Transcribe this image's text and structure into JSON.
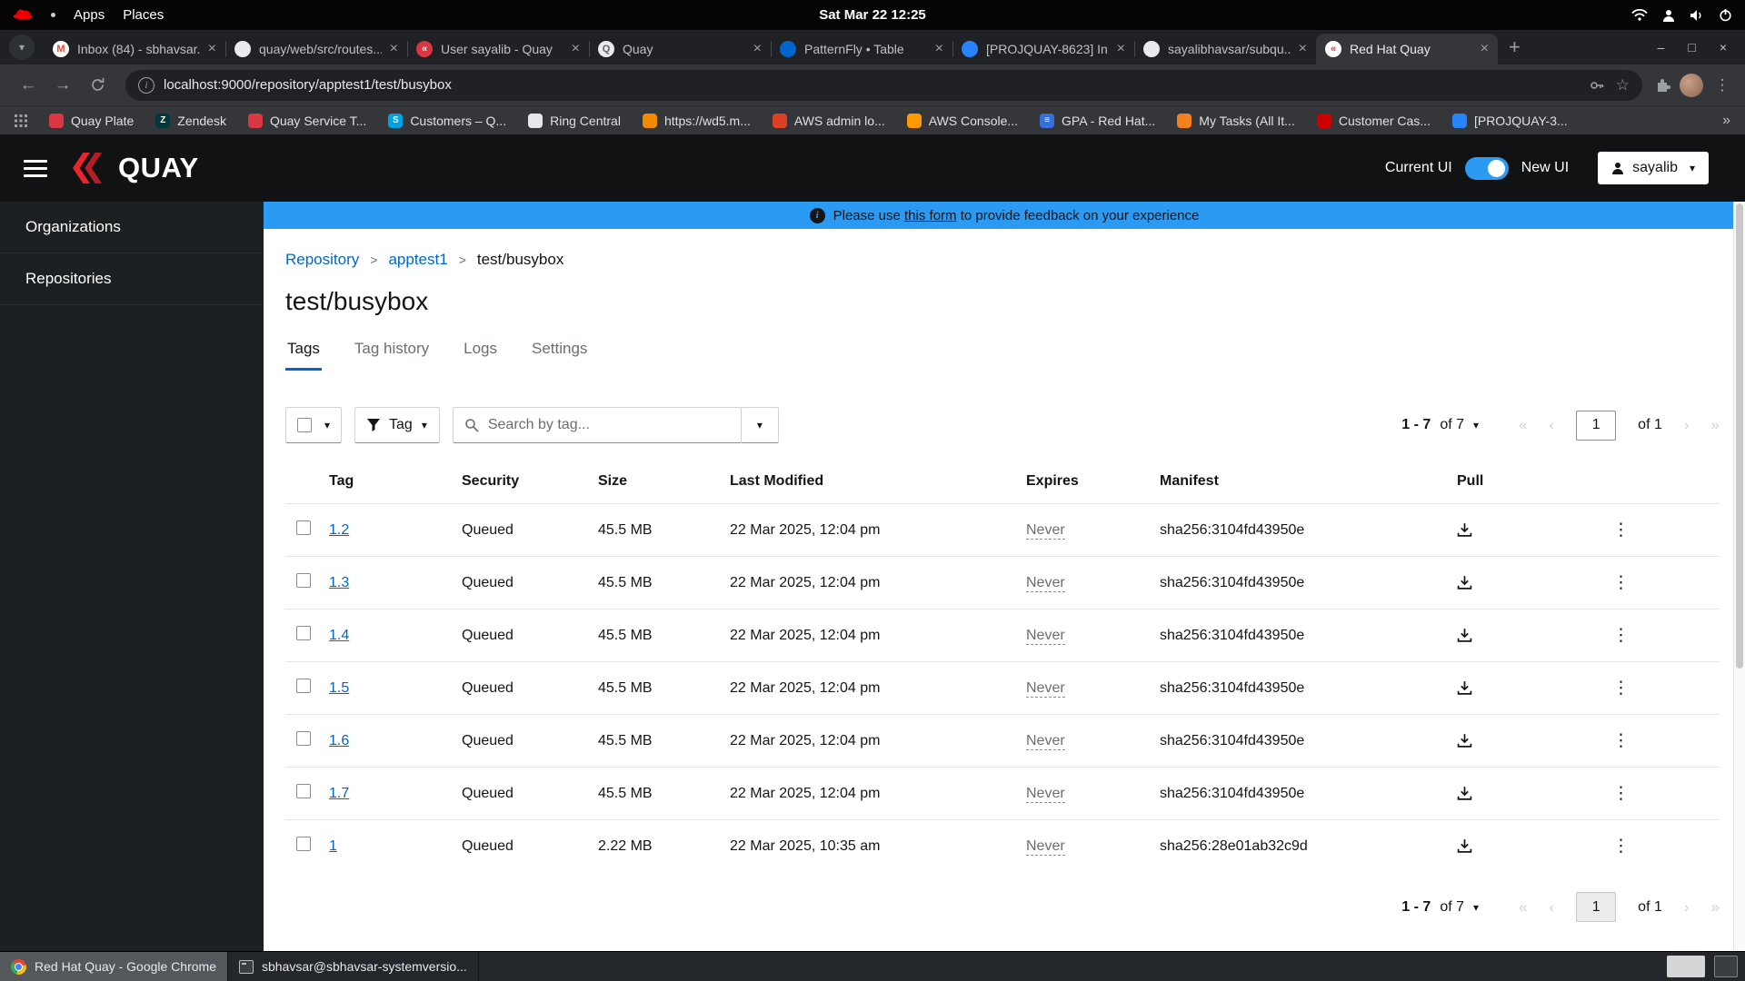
{
  "colors": {
    "accent": "#0066cc",
    "banner_blue": "#2b9af3",
    "quay_red": "#e8242d",
    "switch_blue": "#2b9af3"
  },
  "icons": {
    "caret_down": "▾",
    "kebab": "⋮",
    "close": "×",
    "plus": "+",
    "minimize": "–",
    "maximize": "□",
    "back": "←",
    "forward": "→",
    "star": "☆",
    "first": "«",
    "prev": "‹",
    "next": "›",
    "last": "»",
    "breadcrumb_sep": ">",
    "overflow": "»",
    "info": "i"
  },
  "system_bar": {
    "menus": [
      "Apps",
      "Places"
    ],
    "clock": "Sat Mar 22 12:25"
  },
  "browser": {
    "url": "localhost:9000/repository/apptest1/test/busybox",
    "tabs": [
      {
        "title": "Inbox (84) - sbhavsar...",
        "fav_bg": "#ffffff",
        "fav_fg": "#ea4335",
        "fav_glyph": "M",
        "active": false
      },
      {
        "title": "quay/web/src/routes...",
        "fav_bg": "#e8eaed",
        "fav_fg": "#202124",
        "fav_glyph": "",
        "active": false
      },
      {
        "title": "User sayalib - Quay",
        "fav_bg": "#d93842",
        "fav_fg": "#ffffff",
        "fav_glyph": "«",
        "active": false
      },
      {
        "title": "Quay",
        "fav_bg": "#e8eaed",
        "fav_fg": "#5f6368",
        "fav_glyph": "Q",
        "active": false
      },
      {
        "title": "PatternFly • Table",
        "fav_bg": "#0066cc",
        "fav_fg": "#ffffff",
        "fav_glyph": "",
        "active": false
      },
      {
        "title": "[PROJQUAY-8623] In...",
        "fav_bg": "#2684ff",
        "fav_fg": "#ffffff",
        "fav_glyph": "",
        "active": false
      },
      {
        "title": "sayalibhavsar/subqu...",
        "fav_bg": "#e8eaed",
        "fav_fg": "#202124",
        "fav_glyph": "",
        "active": false
      },
      {
        "title": "Red Hat Quay",
        "fav_bg": "#ffffff",
        "fav_fg": "#d93842",
        "fav_glyph": "«",
        "active": true
      }
    ],
    "bookmarks": [
      {
        "label": "Quay Plate",
        "color": "#d93842"
      },
      {
        "label": "Zendesk",
        "color": "#03363d",
        "glyph": "Z"
      },
      {
        "label": "Quay Service T...",
        "color": "#d93842"
      },
      {
        "label": "Customers – Q...",
        "color": "#00a1e0",
        "glyph": "S"
      },
      {
        "label": "Ring Central",
        "color": "#e8e8e8"
      },
      {
        "label": "https://wd5.m...",
        "color": "#f38b00"
      },
      {
        "label": "AWS admin lo...",
        "color": "#dd3f24"
      },
      {
        "label": "AWS Console...",
        "color": "#ff9900"
      },
      {
        "label": "GPA - Red Hat...",
        "color": "#3470d8",
        "glyph": "≡"
      },
      {
        "label": "My Tasks (All It...",
        "color": "#f4811f"
      },
      {
        "label": "Customer Cas...",
        "color": "#cc0000"
      },
      {
        "label": "[PROJQUAY-3...",
        "color": "#2684ff"
      }
    ]
  },
  "quay": {
    "brand": "QUAY",
    "ui_switch": {
      "left": "Current UI",
      "right": "New UI"
    },
    "user": "sayalib",
    "nav": [
      {
        "label": "Organizations"
      },
      {
        "label": "Repositories"
      }
    ],
    "banner": {
      "pre": "Please use",
      "link": "this form",
      "post": "to provide feedback on your experience"
    },
    "breadcrumb": {
      "items": [
        {
          "label": "Repository"
        },
        {
          "label": "apptest1"
        }
      ],
      "current": "test/busybox"
    },
    "title": "test/busybox",
    "tabs": [
      {
        "label": "Tags",
        "active": true
      },
      {
        "label": "Tag history",
        "active": false
      },
      {
        "label": "Logs",
        "active": false
      },
      {
        "label": "Settings",
        "active": false
      }
    ],
    "toolbar": {
      "filter_label": "Tag",
      "search_placeholder": "Search by tag...",
      "pagination": {
        "range": "1 - 7",
        "of_total": "of 7",
        "page": "1",
        "of_pages": "of 1"
      }
    },
    "table": {
      "columns": {
        "tag": "Tag",
        "security": "Security",
        "size": "Size",
        "modified": "Last Modified",
        "expires": "Expires",
        "manifest": "Manifest",
        "pull": "Pull"
      },
      "rows": [
        {
          "tag": "1.2",
          "security": "Queued",
          "size": "45.5 MB",
          "modified": "22 Mar 2025, 12:04 pm",
          "expires": "Never",
          "manifest": "sha256:3104fd43950e"
        },
        {
          "tag": "1.3",
          "security": "Queued",
          "size": "45.5 MB",
          "modified": "22 Mar 2025, 12:04 pm",
          "expires": "Never",
          "manifest": "sha256:3104fd43950e"
        },
        {
          "tag": "1.4",
          "security": "Queued",
          "size": "45.5 MB",
          "modified": "22 Mar 2025, 12:04 pm",
          "expires": "Never",
          "manifest": "sha256:3104fd43950e"
        },
        {
          "tag": "1.5",
          "security": "Queued",
          "size": "45.5 MB",
          "modified": "22 Mar 2025, 12:04 pm",
          "expires": "Never",
          "manifest": "sha256:3104fd43950e"
        },
        {
          "tag": "1.6",
          "security": "Queued",
          "size": "45.5 MB",
          "modified": "22 Mar 2025, 12:04 pm",
          "expires": "Never",
          "manifest": "sha256:3104fd43950e"
        },
        {
          "tag": "1.7",
          "security": "Queued",
          "size": "45.5 MB",
          "modified": "22 Mar 2025, 12:04 pm",
          "expires": "Never",
          "manifest": "sha256:3104fd43950e"
        },
        {
          "tag": "1",
          "security": "Queued",
          "size": "2.22 MB",
          "modified": "22 Mar 2025, 10:35 am",
          "expires": "Never",
          "manifest": "sha256:28e01ab32c9d"
        }
      ]
    }
  },
  "taskbar": {
    "windows": [
      {
        "label": "Red Hat Quay - Google Chrome",
        "active": true
      },
      {
        "label": "sbhavsar@sbhavsar-systemversio...",
        "active": false
      }
    ]
  }
}
